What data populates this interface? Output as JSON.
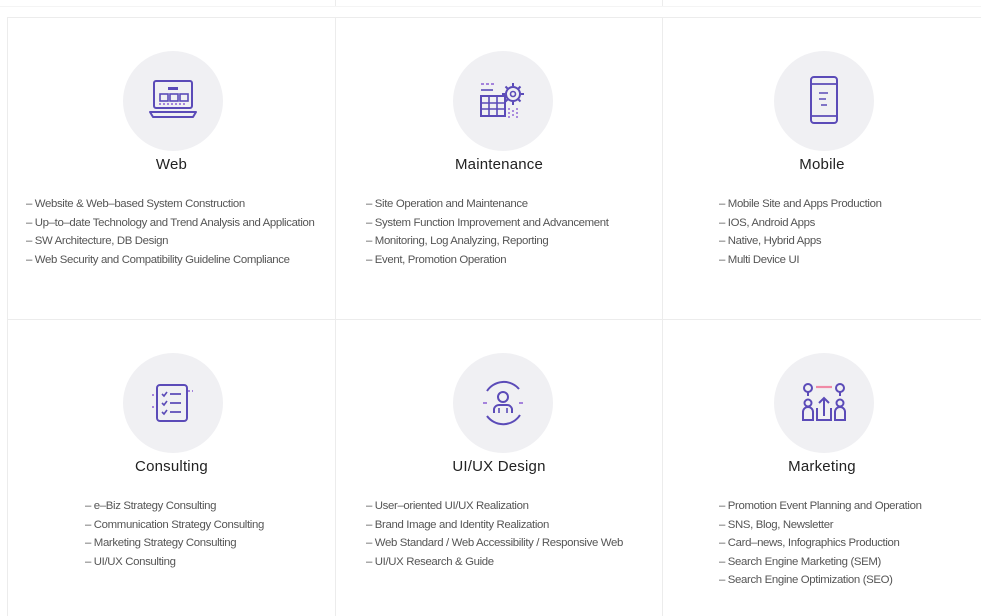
{
  "colors": {
    "accent": "#5b4bb8",
    "accent2": "#8c5fd4",
    "pink": "#f08aa6",
    "circle_bg": "#f0f0f3"
  },
  "services": [
    {
      "title": "Web",
      "icon": "laptop-icon",
      "items": [
        "– Website & Web–based System Construction",
        "– Up–to–date Technology and Trend Analysis and Application",
        "– SW Architecture, DB Design",
        "– Web Security and Compatibility Guideline Compliance"
      ]
    },
    {
      "title": "Maintenance",
      "icon": "gear-icon",
      "items": [
        "– Site Operation and Maintenance",
        "– System Function Improvement and Advancement",
        "– Monitoring, Log Analyzing, Reporting",
        "– Event, Promotion Operation"
      ]
    },
    {
      "title": "Mobile",
      "icon": "smartphone-icon",
      "items": [
        "– Mobile Site and Apps Production",
        "– IOS, Android Apps",
        "– Native, Hybrid Apps",
        "– Multi Device UI"
      ]
    },
    {
      "title": "Consulting",
      "icon": "checklist-icon",
      "items": [
        "– e–Biz Strategy Consulting",
        "– Communication Strategy Consulting",
        "– Marketing Strategy Consulting",
        "– UI/UX Consulting"
      ]
    },
    {
      "title": "UI/UX Design",
      "icon": "user-icon",
      "items": [
        "– User–oriented UI/UX Realization",
        "– Brand Image and Identity Realization",
        "– Web Standard / Web Accessibility / Responsive Web",
        "– UI/UX Research & Guide"
      ]
    },
    {
      "title": "Marketing",
      "icon": "share-icon",
      "items": [
        "– Promotion Event Planning and Operation",
        "– SNS, Blog, Newsletter",
        "– Card–news, Infographics Production",
        "– Search Engine Marketing (SEM)",
        "– Search Engine Optimization (SEO)"
      ]
    }
  ]
}
